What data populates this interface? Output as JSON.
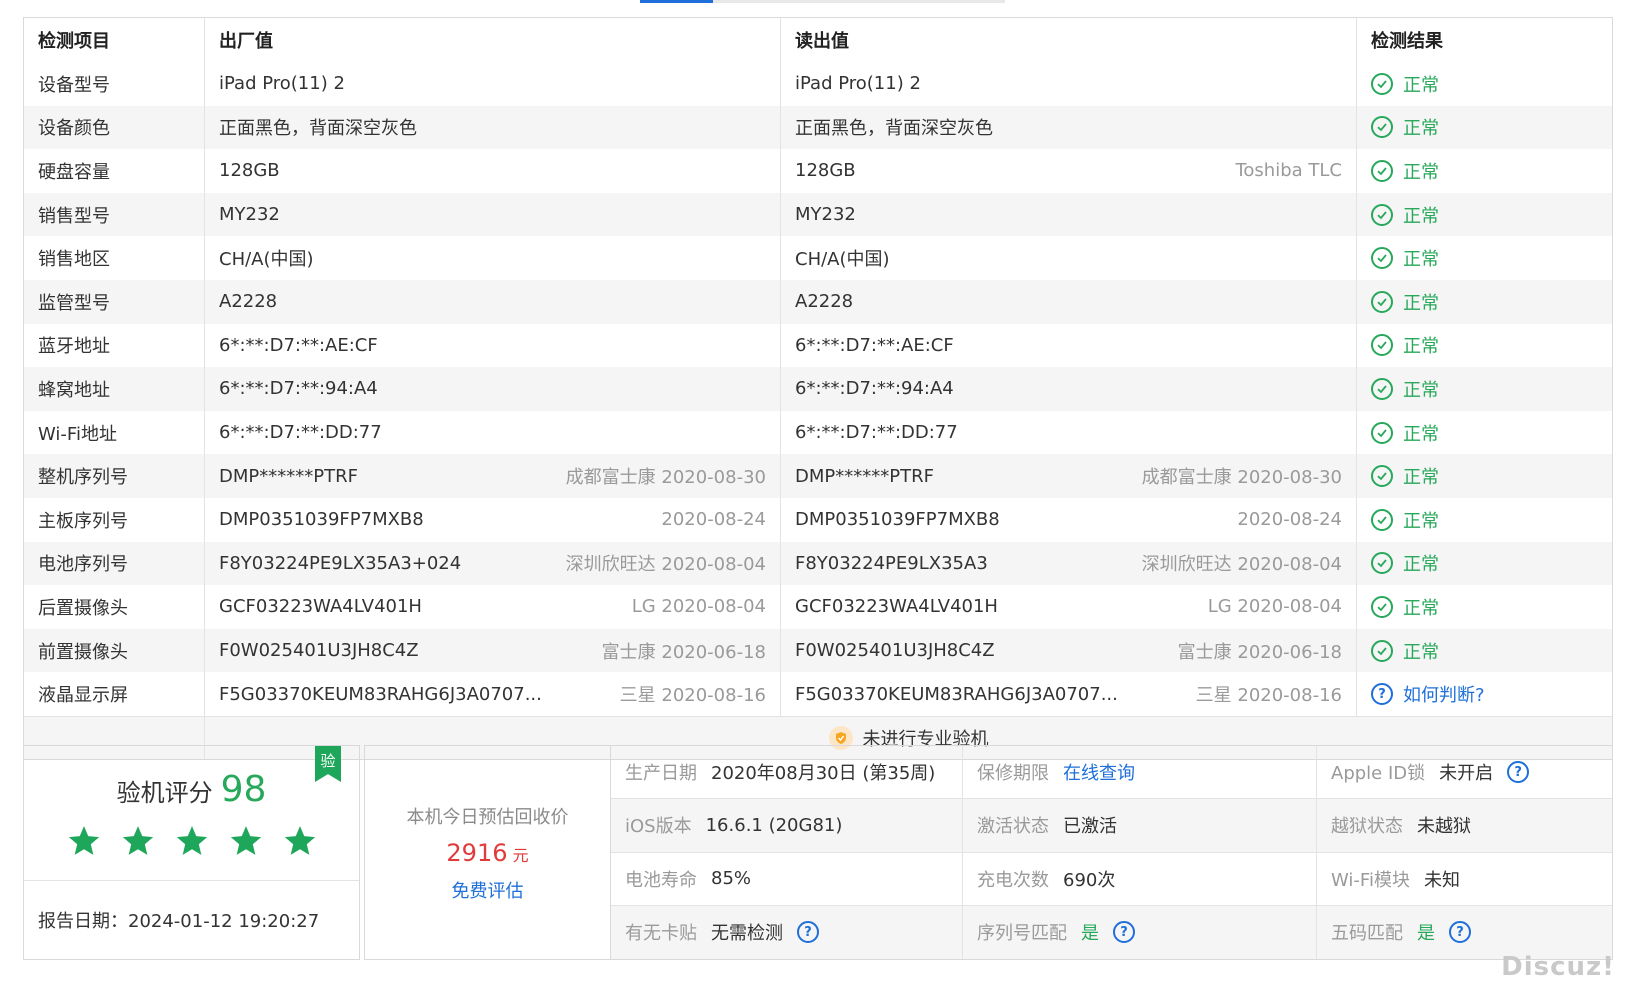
{
  "table": {
    "headers": [
      "检测项目",
      "出厂值",
      "读出值",
      "检测结果"
    ],
    "rows": [
      {
        "item": "设备型号",
        "factory": "iPad Pro(11) 2",
        "factory_sub": "",
        "read": "iPad Pro(11) 2",
        "read_sub": "",
        "result": "正常",
        "status": "ok"
      },
      {
        "item": "设备颜色",
        "factory": "正面黑色，背面深空灰色",
        "factory_sub": "",
        "read": "正面黑色，背面深空灰色",
        "read_sub": "",
        "result": "正常",
        "status": "ok"
      },
      {
        "item": "硬盘容量",
        "factory": "128GB",
        "factory_sub": "",
        "read": "128GB",
        "read_sub": "Toshiba TLC",
        "result": "正常",
        "status": "ok"
      },
      {
        "item": "销售型号",
        "factory": "MY232",
        "factory_sub": "",
        "read": "MY232",
        "read_sub": "",
        "result": "正常",
        "status": "ok"
      },
      {
        "item": "销售地区",
        "factory": "CH/A(中国)",
        "factory_sub": "",
        "read": "CH/A(中国)",
        "read_sub": "",
        "result": "正常",
        "status": "ok"
      },
      {
        "item": "监管型号",
        "factory": "A2228",
        "factory_sub": "",
        "read": "A2228",
        "read_sub": "",
        "result": "正常",
        "status": "ok"
      },
      {
        "item": "蓝牙地址",
        "factory": "6*:**:D7:**:AE:CF",
        "factory_sub": "",
        "read": "6*:**:D7:**:AE:CF",
        "read_sub": "",
        "result": "正常",
        "status": "ok"
      },
      {
        "item": "蜂窝地址",
        "factory": "6*:**:D7:**:94:A4",
        "factory_sub": "",
        "read": "6*:**:D7:**:94:A4",
        "read_sub": "",
        "result": "正常",
        "status": "ok"
      },
      {
        "item": "Wi-Fi地址",
        "factory": "6*:**:D7:**:DD:77",
        "factory_sub": "",
        "read": "6*:**:D7:**:DD:77",
        "read_sub": "",
        "result": "正常",
        "status": "ok"
      },
      {
        "item": "整机序列号",
        "factory": "DMP******PTRF",
        "factory_sub": "成都富士康 2020-08-30",
        "read": "DMP******PTRF",
        "read_sub": "成都富士康 2020-08-30",
        "result": "正常",
        "status": "ok"
      },
      {
        "item": "主板序列号",
        "factory": "DMP0351039FP7MXB8",
        "factory_sub": "2020-08-24",
        "read": "DMP0351039FP7MXB8",
        "read_sub": "2020-08-24",
        "result": "正常",
        "status": "ok"
      },
      {
        "item": "电池序列号",
        "factory": "F8Y03224PE9LX35A3+024",
        "factory_sub": "深圳欣旺达 2020-08-04",
        "read": "F8Y03224PE9LX35A3",
        "read_sub": "深圳欣旺达 2020-08-04",
        "result": "正常",
        "status": "ok"
      },
      {
        "item": "后置摄像头",
        "factory": "GCF03223WA4LV401H",
        "factory_sub": "LG 2020-08-04",
        "read": "GCF03223WA4LV401H",
        "read_sub": "LG 2020-08-04",
        "result": "正常",
        "status": "ok"
      },
      {
        "item": "前置摄像头",
        "factory": "F0W025401U3JH8C4Z",
        "factory_sub": "富士康 2020-06-18",
        "read": "F0W025401U3JH8C4Z",
        "read_sub": "富士康 2020-06-18",
        "result": "正常",
        "status": "ok"
      },
      {
        "item": "液晶显示屏",
        "factory": "F5G03370KEUM83RAHG6J3A0707...",
        "factory_sub": "三星 2020-08-16",
        "read": "F5G03370KEUM83RAHG6J3A0707...",
        "read_sub": "三星 2020-08-16",
        "result": "如何判断?",
        "status": "unknown"
      }
    ],
    "footer_note": "未进行专业验机"
  },
  "score": {
    "label": "验机评分",
    "value": "98",
    "stars": 5,
    "badge": "验",
    "report_date": "报告日期：2024-01-12 19:20:27"
  },
  "price": {
    "label": "本机今日预估回收价",
    "value": "2916",
    "unit": "元",
    "free_eval": "免费评估"
  },
  "info": {
    "production_date_label": "生产日期",
    "production_date": "2020年08月30日 (第35周)",
    "warranty_label": "保修期限",
    "warranty": "在线查询",
    "appleid_label": "Apple ID锁",
    "appleid": "未开启",
    "ios_label": "iOS版本",
    "ios": "16.6.1 (20G81)",
    "activation_label": "激活状态",
    "activation": "已激活",
    "jailbreak_label": "越狱状态",
    "jailbreak": "未越狱",
    "battery_label": "电池寿命",
    "battery": "85%",
    "charge_label": "充电次数",
    "charge": "690次",
    "wifi_label": "Wi-Fi模块",
    "wifi": "未知",
    "sticker_label": "有无卡贴",
    "sticker": "无需检测",
    "serial_match_label": "序列号匹配",
    "serial_match": "是",
    "five_code_label": "五码匹配",
    "five_code": "是"
  },
  "watermark": "Discuz!",
  "colors": {
    "ok": "#27a85a",
    "link": "#1e6fd9",
    "price": "#e03a3a"
  }
}
